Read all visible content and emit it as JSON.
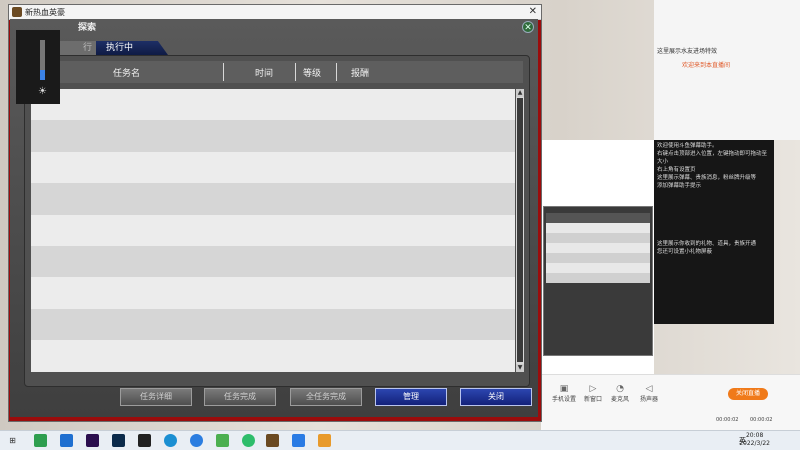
{
  "window": {
    "title": "新热血英豪",
    "close_glyph": "✕"
  },
  "panel": {
    "title": "探索",
    "tabs": [
      {
        "label": "行"
      },
      {
        "label": "执行中"
      }
    ],
    "columns": [
      "任务名",
      "时间",
      "等级",
      "报酬"
    ],
    "rows": [
      "",
      "",
      "",
      "",
      "",
      "",
      "",
      "",
      ""
    ],
    "buttons": [
      "任务详细",
      "任务完成",
      "全任务完成",
      "管理",
      "关闭"
    ]
  },
  "stream": {
    "tools": [
      "手机设置",
      "新窗口",
      "麦克风",
      "扬声器"
    ],
    "live_button": "关闭直播",
    "timers": [
      "00:00:02",
      "00:00:02"
    ],
    "chat_lines": [
      "欢迎使用斗鱼弹幕助手。",
      "右键点击顶部进入位置，左键拖动即可拖动至大小",
      "右上角有设置页",
      "这里展示弹幕、贵族消息，粉丝牌升级等",
      "添加弹幕助手提示",
      "这里展示你收到的礼物、道具，贵族开通",
      "您还可设置小礼物屏蔽"
    ],
    "side_lines": [
      "这里展示水友进场特效",
      "欢迎来到本直播间"
    ]
  },
  "taskbar": {
    "time": "20:08",
    "date": "2022/3/22",
    "ime": "英"
  },
  "colors": {
    "accent_blue": "#13217a",
    "window_border": "#9b0c0c",
    "live_orange": "#f07a1a"
  }
}
